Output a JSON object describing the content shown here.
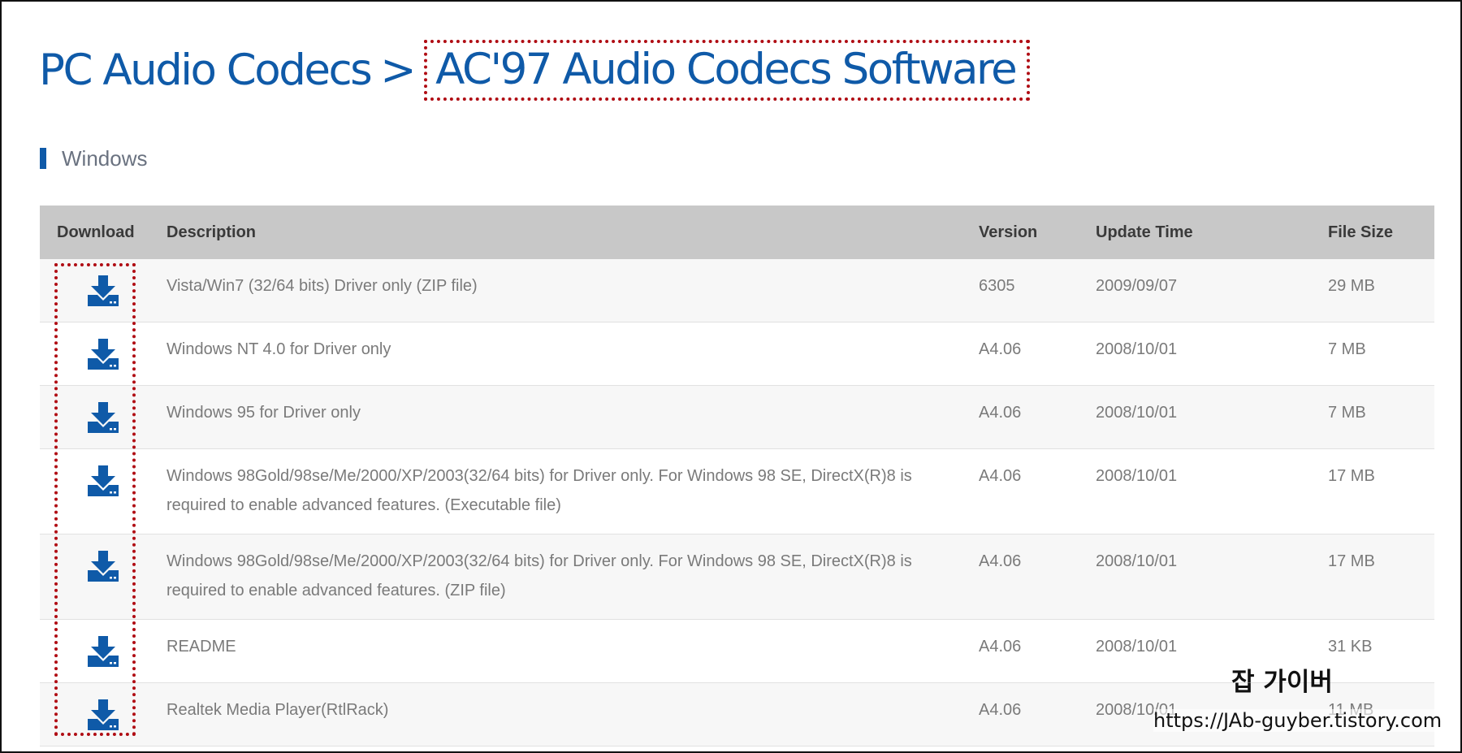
{
  "breadcrumb": {
    "parent": "PC Audio Codecs",
    "separator": ">",
    "current": "AC'97 Audio Codecs Software"
  },
  "section": {
    "title": "Windows",
    "accent_color": "#0f5aa8"
  },
  "table": {
    "headers": {
      "download": "Download",
      "description": "Description",
      "version": "Version",
      "update_time": "Update Time",
      "file_size": "File Size"
    },
    "rows": [
      {
        "description": "Vista/Win7 (32/64 bits) Driver only (ZIP file)",
        "version": "6305",
        "update_time": "2009/09/07",
        "file_size": "29 MB"
      },
      {
        "description": "Windows NT 4.0 for Driver only",
        "version": "A4.06",
        "update_time": "2008/10/01",
        "file_size": "7 MB"
      },
      {
        "description": "Windows 95 for Driver only",
        "version": "A4.06",
        "update_time": "2008/10/01",
        "file_size": "7 MB"
      },
      {
        "description": "Windows 98Gold/98se/Me/2000/XP/2003(32/64 bits) for Driver only. For Windows 98 SE, DirectX(R)8 is required to enable advanced features. (Executable file)",
        "version": "A4.06",
        "update_time": "2008/10/01",
        "file_size": "17 MB"
      },
      {
        "description": "Windows 98Gold/98se/Me/2000/XP/2003(32/64 bits) for Driver only. For Windows 98 SE, DirectX(R)8 is required to enable advanced features. (ZIP file)",
        "version": "A4.06",
        "update_time": "2008/10/01",
        "file_size": "17 MB"
      },
      {
        "description": "README",
        "version": "A4.06",
        "update_time": "2008/10/01",
        "file_size": "31 KB"
      },
      {
        "description": "Realtek Media Player(RtlRack)",
        "version": "A4.06",
        "update_time": "2008/10/01",
        "file_size": "11 MB"
      }
    ],
    "download_icon": "download-icon"
  },
  "colors": {
    "link_blue": "#0f5aa8",
    "highlight_red": "#b00d14",
    "header_gray": "#c8c8c8"
  },
  "watermark": {
    "title": "잡 가이버",
    "url": "https://JAb-guyber.tistory.com"
  }
}
